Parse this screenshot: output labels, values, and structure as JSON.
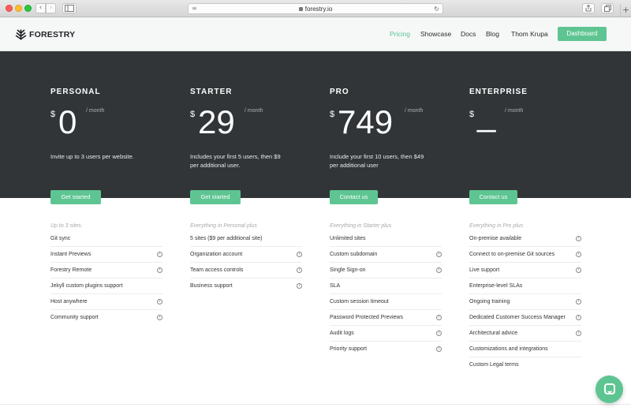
{
  "browser": {
    "url": "forestry.io",
    "nav_back_icon": "‹",
    "nav_forward_icon": "›",
    "reload_icon": "↻",
    "plus_icon": "+"
  },
  "header": {
    "logo_text": "FORESTRY",
    "nav": [
      "Pricing",
      "Showcase",
      "Docs",
      "Blog",
      "Thom Krupa"
    ],
    "active_nav": "Pricing",
    "dashboard_label": "Dashboard"
  },
  "colors": {
    "accent": "#5ec592",
    "dark_band": "#313538",
    "nav_active": "#5bc495"
  },
  "plans": [
    {
      "name": "PERSONAL",
      "currency": "$",
      "price": "0",
      "period": "/ month",
      "description": "Invite up to 3 users per website.",
      "cta": "Get started",
      "features_heading": "Up to 3 sites.",
      "features": [
        {
          "label": "Git sync",
          "info": false
        },
        {
          "label": "Instant Previews",
          "info": true
        },
        {
          "label": "Forestry Remote",
          "info": true
        },
        {
          "label": "Jekyll custom plugins support",
          "info": false
        },
        {
          "label": "Host anywhere",
          "info": true
        },
        {
          "label": "Community support",
          "info": true
        }
      ]
    },
    {
      "name": "STARTER",
      "currency": "$",
      "price": "29",
      "period": "/ month",
      "description": "Includes your first 5 users, then $9 per additional user.",
      "cta": "Get started",
      "features_heading": "Everything in Personal plus",
      "features": [
        {
          "label": "5 sites ($9 per additional site)",
          "info": false
        },
        {
          "label": "Organization account",
          "info": true
        },
        {
          "label": "Team access controls",
          "info": true
        },
        {
          "label": "Business support",
          "info": true
        }
      ]
    },
    {
      "name": "PRO",
      "currency": "$",
      "price": "749",
      "period": "/ month",
      "description": "Include your first 10 users, then $49 per additional user",
      "cta": "Contact us",
      "features_heading": "Everything in Starter plus",
      "features": [
        {
          "label": "Unlimited sites",
          "info": false
        },
        {
          "label": "Custom subdomain",
          "info": true
        },
        {
          "label": "Single Sign-on",
          "info": true
        },
        {
          "label": "SLA",
          "info": false
        },
        {
          "label": "Custom session timeout",
          "info": false
        },
        {
          "label": "Password Protected Previews",
          "info": true
        },
        {
          "label": "Audit logs",
          "info": true
        },
        {
          "label": "Priority support",
          "info": true
        }
      ]
    },
    {
      "name": "ENTERPRISE",
      "currency": "$",
      "price": "_",
      "period": "/ month",
      "description": "",
      "cta": "Contact us",
      "features_heading": "Everything in Pro plus",
      "features": [
        {
          "label": "On-premise available",
          "info": true
        },
        {
          "label": "Connect to on-premise Git sources",
          "info": true
        },
        {
          "label": "Live support",
          "info": true
        },
        {
          "label": "Enterprise-level SLAs",
          "info": false
        },
        {
          "label": "Ongoing training",
          "info": true
        },
        {
          "label": "Dedicated Customer Success Manager",
          "info": true
        },
        {
          "label": "Architectural advice",
          "info": true
        },
        {
          "label": "Customizations and integrations",
          "info": false
        },
        {
          "label": "Custom Legal terms",
          "info": false
        }
      ]
    }
  ]
}
